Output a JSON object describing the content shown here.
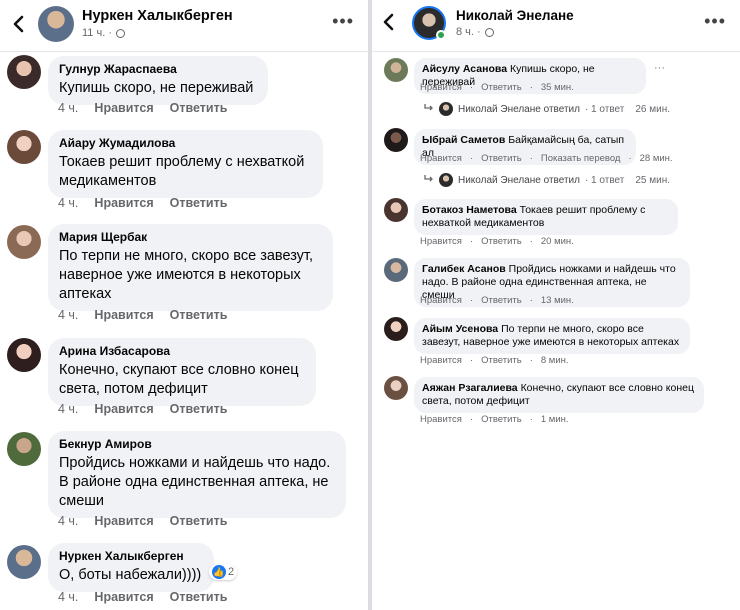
{
  "left": {
    "header": {
      "name": "Нуркен Халыкберген",
      "time": "11 ч. ·",
      "more": "•••"
    },
    "comments": [
      {
        "author": "Гулнур Жараспаева",
        "text": "Купишь скоро, не переживай",
        "time": "4 ч.",
        "like": "Нравится",
        "reply": "Ответить"
      },
      {
        "author": "Айару Жумадилова",
        "text": "Токаев решит проблему с нехваткой медикаментов",
        "time": "4 ч.",
        "like": "Нравится",
        "reply": "Ответить"
      },
      {
        "author": "Мария Щербак",
        "text": "По терпи не много, скоро все завезут, наверное уже имеются в некоторых аптеках",
        "time": "4 ч.",
        "like": "Нравится",
        "reply": "Ответить"
      },
      {
        "author": "Арина Избасарова",
        "text": "Конечно, скупают все словно конец света, потом дефицит",
        "time": "4 ч.",
        "like": "Нравится",
        "reply": "Ответить"
      },
      {
        "author": "Бекнур Амиров",
        "text": "Пройдись ножками и найдешь что надо. В районе одна единственная аптека, не смеши",
        "time": "4 ч.",
        "like": "Нравится",
        "reply": "Ответить"
      },
      {
        "author": "Нуркен Халыкберген",
        "text": "О, боты набежали))))",
        "time": "4 ч.",
        "like": "Нравится",
        "reply": "Ответить",
        "reaction_count": "2"
      }
    ]
  },
  "right": {
    "header": {
      "name": "Николай Энелане",
      "time": "8 ч. ·",
      "more": "•••"
    },
    "comments": [
      {
        "author": "Айсулу Асанова",
        "text": "Купишь скоро, не переживай",
        "actions": [
          "Нравится",
          "·",
          "Ответить",
          "·",
          "35 мин."
        ],
        "more": "···",
        "reply": {
          "name": "Николай Энелане ответил",
          "count": "· 1 ответ",
          "time": "26 мин."
        }
      },
      {
        "author": "Ыбрай Саметов",
        "text": "Байқамайсың ба, сатып ал",
        "actions": [
          "Нравится",
          "·",
          "Ответить",
          "·",
          "Показать перевод",
          "·",
          "28 мин."
        ],
        "reply": {
          "name": "Николай Энелане ответил",
          "count": "· 1 ответ",
          "time": "25 мин."
        }
      },
      {
        "author": "Ботакоз Наметова",
        "text": "Токаев решит проблему с нехваткой медикаментов",
        "actions": [
          "Нравится",
          "·",
          "Ответить",
          "·",
          "20 мин."
        ]
      },
      {
        "author": "Галибек Асанов",
        "text": "Пройдись ножками и найдешь что надо. В районе одна единственная аптека, не смеши",
        "actions": [
          "Нравится",
          "·",
          "Ответить",
          "·",
          "13 мин."
        ]
      },
      {
        "author": "Айым Усенова",
        "text": "По терпи не много, скоро все завезут, наверное уже имеются в некоторых аптеках",
        "actions": [
          "Нравится",
          "·",
          "Ответить",
          "·",
          "8 мин."
        ]
      },
      {
        "author": "Аяжан Рзагалиева",
        "text": "Конечно, скупают все словно конец света, потом дефицит",
        "actions": [
          "Нравится",
          "·",
          "Ответить",
          "·",
          "1 мин."
        ]
      }
    ]
  },
  "colors": {
    "bubble": "#f0f2f5",
    "secondary_text": "#65676b",
    "like_blue": "#1877f2",
    "online_green": "#31a24c"
  }
}
